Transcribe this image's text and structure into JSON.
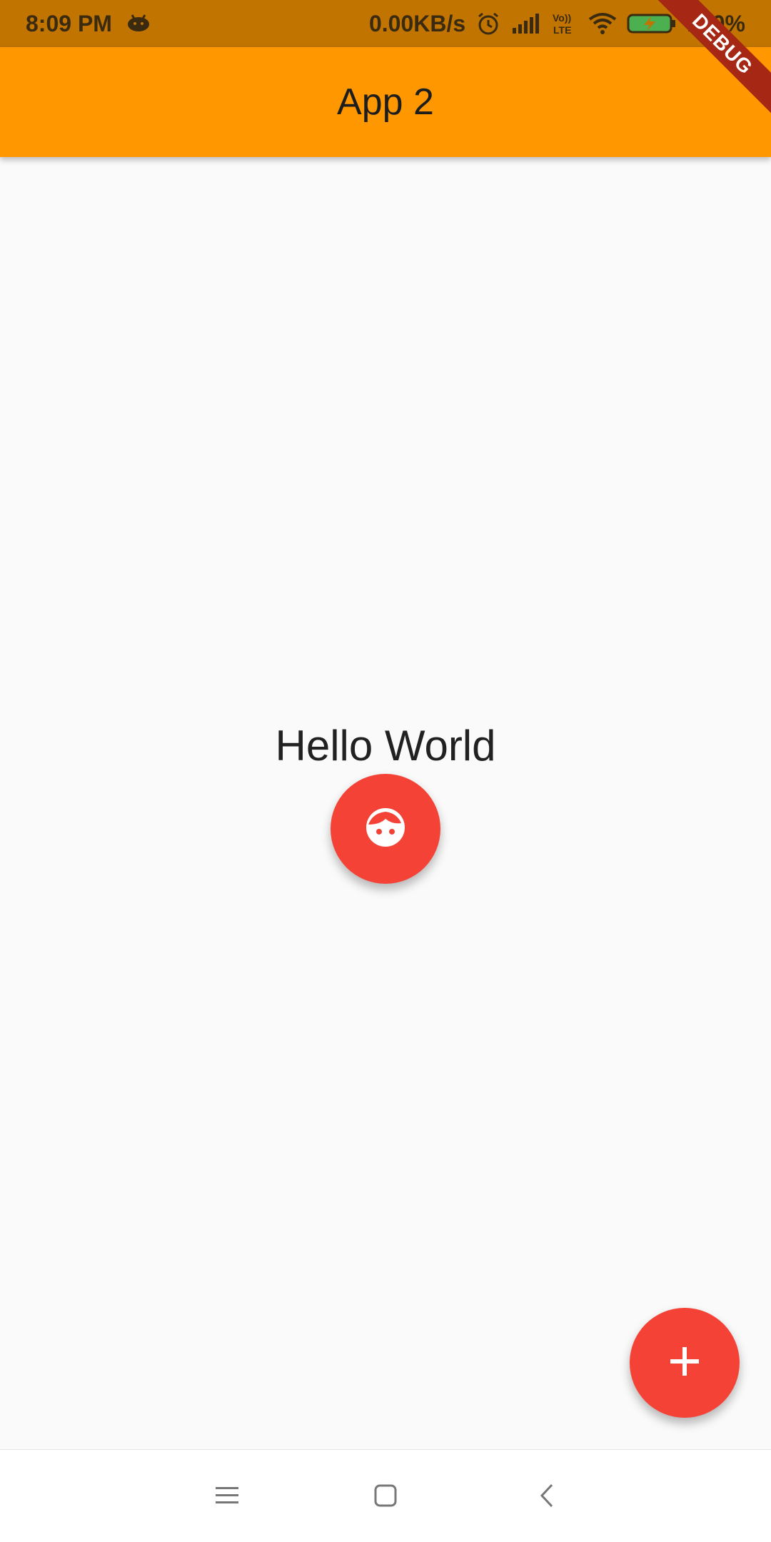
{
  "status_bar": {
    "time": "8:09 PM",
    "net_speed": "0.00KB/s",
    "volte": "Vo)) LTE",
    "battery": "100%",
    "icons": [
      "android-icon",
      "alarm-icon",
      "signal-icon",
      "volte-icon",
      "wifi-icon",
      "battery-charging-icon"
    ]
  },
  "debug_banner": "DEBUG",
  "app_bar": {
    "title": "App 2"
  },
  "main": {
    "text": "Hello World",
    "center_button_icon": "face-icon",
    "fab_icon": "add-icon"
  },
  "nav_bar": {
    "icons": [
      "menu-icon",
      "home-icon",
      "back-icon"
    ]
  },
  "colors": {
    "status_bar": "#c17400",
    "app_bar": "#ff9800",
    "fab": "#f44336",
    "background": "#fafafa",
    "debug_ribbon": "#a52714"
  }
}
